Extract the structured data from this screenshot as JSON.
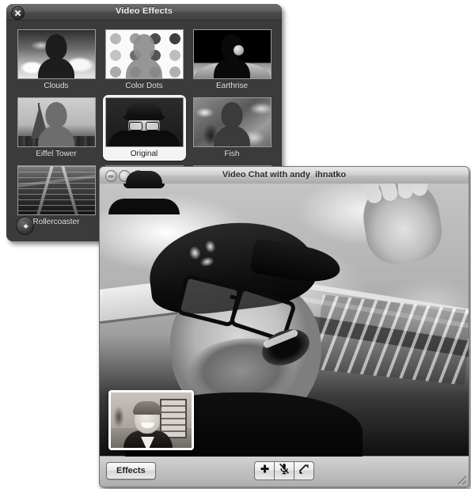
{
  "effects_panel": {
    "title": "Video Effects",
    "close_icon": "close-x-icon",
    "back_icon": "back-arrow-icon",
    "effects": [
      {
        "label": "Clouds",
        "selected": false
      },
      {
        "label": "Color Dots",
        "selected": false
      },
      {
        "label": "Earthrise",
        "selected": false
      },
      {
        "label": "Eiffel Tower",
        "selected": false
      },
      {
        "label": "Original",
        "selected": true
      },
      {
        "label": "Fish",
        "selected": false
      }
    ],
    "second_page_effects": [
      {
        "label": "Rollercoaster",
        "selected": false
      }
    ]
  },
  "chat_window": {
    "title": "Video Chat with andy  ihnatko",
    "traffic_lights": {
      "close": "close-button",
      "minimize": "minimize-button",
      "zoom": "zoom-button"
    },
    "video": {
      "main_view_description": "Black and white video of a man wearing a baseball cap and glasses on a rollercoaster",
      "self_view_description": "Self-view thumbnail of a smiling man indoors"
    },
    "toolbar": {
      "effects_label": "Effects",
      "buttons": [
        {
          "name": "add-participant-button",
          "icon": "plus-icon"
        },
        {
          "name": "mute-button",
          "icon": "microphone-muted-icon"
        },
        {
          "name": "fullscreen-button",
          "icon": "fullscreen-arrows-icon"
        }
      ],
      "resize_grip": "resize-grip"
    }
  }
}
